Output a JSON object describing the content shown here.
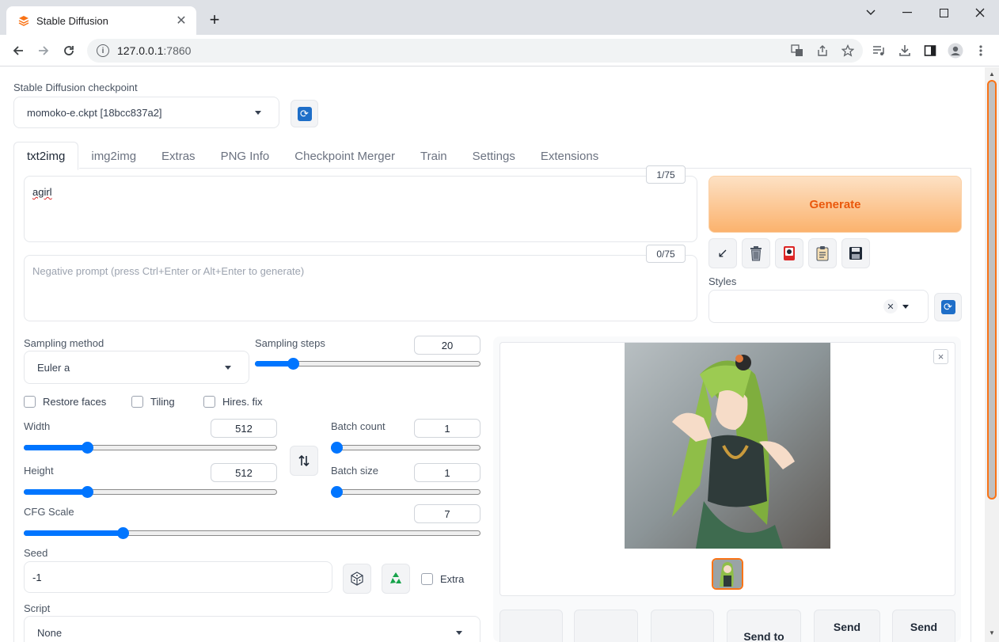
{
  "browser": {
    "tab_title": "Stable Diffusion",
    "new_tab": "+",
    "tab_close": "✕",
    "url_host": "127.0.0.1",
    "url_port": ":7860"
  },
  "checkpoint": {
    "label": "Stable Diffusion checkpoint",
    "value": "momoko-e.ckpt [18bcc837a2]"
  },
  "tabs": [
    {
      "label": "txt2img",
      "active": true
    },
    {
      "label": "img2img"
    },
    {
      "label": "Extras"
    },
    {
      "label": "PNG Info"
    },
    {
      "label": "Checkpoint Merger"
    },
    {
      "label": "Train"
    },
    {
      "label": "Settings"
    },
    {
      "label": "Extensions"
    }
  ],
  "prompt": {
    "value": "agirl",
    "counter": "1/75"
  },
  "negative_prompt": {
    "placeholder": "Negative prompt (press Ctrl+Enter or Alt+Enter to generate)",
    "counter": "0/75"
  },
  "generate_label": "Generate",
  "styles": {
    "label": "Styles",
    "clear": "✕"
  },
  "sampling": {
    "method_label": "Sampling method",
    "method_value": "Euler a",
    "steps_label": "Sampling steps",
    "steps_value": "20",
    "steps_fraction": 0.15
  },
  "options": {
    "restore_faces": "Restore faces",
    "tiling": "Tiling",
    "hires_fix": "Hires. fix"
  },
  "width": {
    "label": "Width",
    "value": "512",
    "fraction": 0.24
  },
  "height": {
    "label": "Height",
    "value": "512",
    "fraction": 0.24
  },
  "batch_count": {
    "label": "Batch count",
    "value": "1",
    "fraction": 0.0
  },
  "batch_size": {
    "label": "Batch size",
    "value": "1",
    "fraction": 0.0
  },
  "cfg": {
    "label": "CFG Scale",
    "value": "7",
    "fraction": 0.21
  },
  "seed": {
    "label": "Seed",
    "value": "-1",
    "extra": "Extra"
  },
  "script": {
    "label": "Script",
    "value": "None"
  },
  "gallery_close": "×",
  "send_buttons": [
    "",
    "",
    "",
    "Send to",
    "Send",
    "Send"
  ],
  "colors": {
    "accent": "#0075ff",
    "generate_text": "#ea580c",
    "refresh_blue": "#1e6ec8"
  }
}
